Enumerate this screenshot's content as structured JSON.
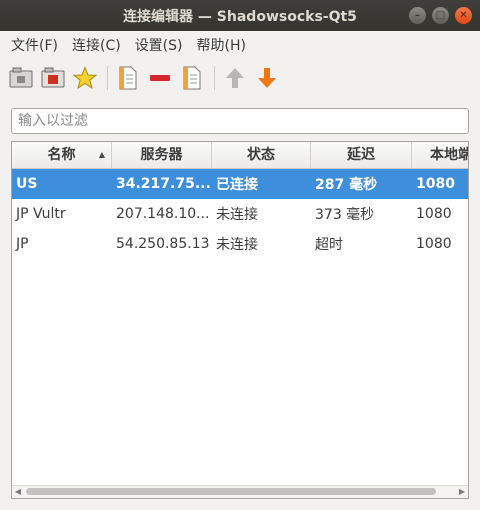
{
  "window": {
    "title": "连接编辑器 — Shadowsocks-Qt5"
  },
  "menu": {
    "items": [
      "文件(F)",
      "连接(C)",
      "设置(S)",
      "帮助(H)"
    ]
  },
  "filter": {
    "placeholder": "输入以过滤",
    "value": ""
  },
  "table": {
    "columns": [
      "名称",
      "服务器",
      "状态",
      "延迟",
      "本地端口"
    ],
    "sort": {
      "column": "名称",
      "direction": "ascending"
    },
    "rows": [
      {
        "name": "US",
        "server": "34.217.75....",
        "status": "已连接",
        "latency": "287 毫秒",
        "local_port": "1080",
        "selected": true
      },
      {
        "name": "JP Vultr",
        "server": "207.148.10...",
        "status": "未连接",
        "latency": "373 毫秒",
        "local_port": "1080",
        "selected": false
      },
      {
        "name": "JP",
        "server": "54.250.85.13",
        "status": "未连接",
        "latency": "超时",
        "local_port": "1080",
        "selected": false
      }
    ]
  },
  "toolbar": {
    "buttons": [
      "import-gui-config-icon",
      "import-config-icon",
      "favorite-star-icon",
      "add-connection-icon",
      "delete-connection-icon",
      "edit-connection-icon",
      "move-up-icon",
      "move-down-icon"
    ]
  },
  "colors": {
    "titlebar": "#3a3935",
    "selection": "#3d8edb",
    "close_button": "#e9541e",
    "accent_arrow": "#f07818"
  }
}
